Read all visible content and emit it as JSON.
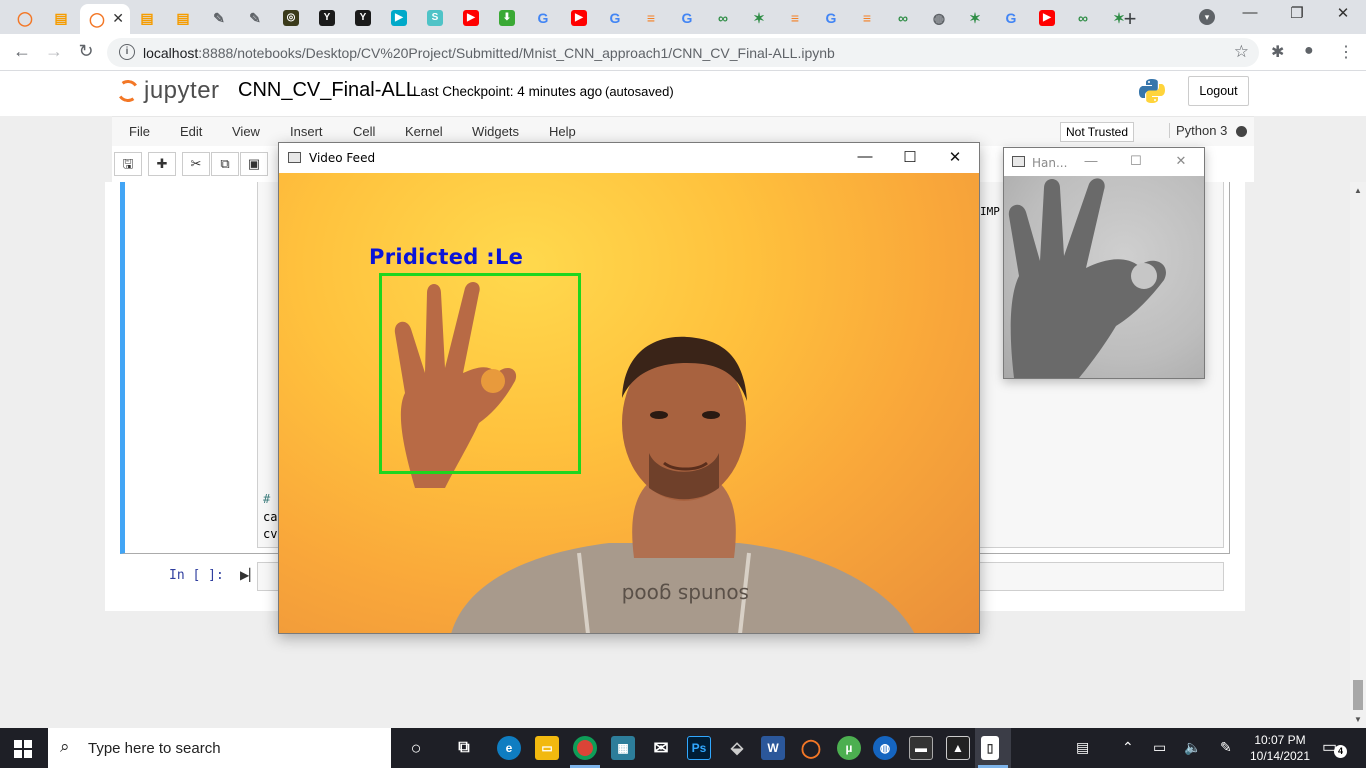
{
  "browser": {
    "tabs": [
      {
        "icon": "jupyter-icon",
        "color": "#f37726",
        "glyph": "◯"
      },
      {
        "icon": "notebook-icon",
        "color": "#f59c00",
        "glyph": "▤"
      },
      {
        "icon": "jupyter-icon",
        "color": "#f37726",
        "glyph": "◯",
        "active": true
      },
      {
        "icon": "notebook-icon",
        "color": "#f59c00",
        "glyph": "▤"
      },
      {
        "icon": "notebook-icon",
        "color": "#f59c00",
        "glyph": "▤"
      },
      {
        "icon": "feather-icon",
        "color": "#5f6368",
        "glyph": "✎"
      },
      {
        "icon": "feather-icon",
        "color": "#5f6368",
        "glyph": "✎"
      },
      {
        "icon": "library-icon",
        "color": "#3b3b1b",
        "glyph": "◎"
      },
      {
        "icon": "y-icon",
        "color": "#1b1b1b",
        "glyph": "Y"
      },
      {
        "icon": "y-icon",
        "color": "#1b1b1b",
        "glyph": "Y"
      },
      {
        "icon": "play-icon",
        "color": "#00a9c9",
        "glyph": "▶"
      },
      {
        "icon": "s-icon",
        "color": "#4fc3c7",
        "glyph": "S"
      },
      {
        "icon": "youtube-icon",
        "color": "#ff0000",
        "glyph": "▶"
      },
      {
        "icon": "download-icon",
        "color": "#3aa935",
        "glyph": "⬇"
      },
      {
        "icon": "google-icon",
        "color": "#ffffff",
        "glyph": "G"
      },
      {
        "icon": "youtube-icon",
        "color": "#ff0000",
        "glyph": "▶"
      },
      {
        "icon": "google-icon",
        "color": "#ffffff",
        "glyph": "G"
      },
      {
        "icon": "stackoverflow-icon",
        "color": "#f48024",
        "glyph": "≡"
      },
      {
        "icon": "google-icon",
        "color": "#ffffff",
        "glyph": "G"
      },
      {
        "icon": "geeks-icon",
        "color": "#2f8d46",
        "glyph": "∞"
      },
      {
        "icon": "plant-icon",
        "color": "#2f8d46",
        "glyph": "✶"
      },
      {
        "icon": "stackoverflow-icon",
        "color": "#f48024",
        "glyph": "≡"
      },
      {
        "icon": "google-icon",
        "color": "#ffffff",
        "glyph": "G"
      },
      {
        "icon": "stackoverflow-icon",
        "color": "#f48024",
        "glyph": "≡"
      },
      {
        "icon": "geeks-icon",
        "color": "#2f8d46",
        "glyph": "∞"
      },
      {
        "icon": "globe-icon",
        "color": "#5f6368",
        "glyph": "◍"
      },
      {
        "icon": "plant-icon",
        "color": "#2f8d46",
        "glyph": "✶"
      },
      {
        "icon": "google-icon",
        "color": "#ffffff",
        "glyph": "G"
      },
      {
        "icon": "youtube-icon",
        "color": "#ff0000",
        "glyph": "▶"
      },
      {
        "icon": "geeks-icon",
        "color": "#2f8d46",
        "glyph": "∞"
      },
      {
        "icon": "plant-icon",
        "color": "#2f8d46",
        "glyph": "✶"
      }
    ],
    "url_host": "localhost",
    "url_rest": ":8888/notebooks/Desktop/CV%20Project/Submitted/Mnist_CNN_approach1/CNN_CV_Final-ALL.ipynb"
  },
  "jupyter": {
    "logo_text": "jupyter",
    "notebook_name": "CNN_CV_Final-ALL",
    "checkpoint": "Last Checkpoint: 4 minutes ago",
    "autosave": "(autosaved)",
    "logout": "Logout",
    "menu": [
      "File",
      "Edit",
      "View",
      "Insert",
      "Cell",
      "Kernel",
      "Widgets",
      "Help"
    ],
    "trust": "Not Trusted",
    "kernel": "Python 3",
    "code_fragments": [
      "#",
      "ca",
      "cv",
      "IMP"
    ],
    "prompt": "In [ ]:"
  },
  "video_window": {
    "title": "Video Feed",
    "prediction": "Pridicted :Le",
    "box_color": "#1ed61e",
    "label_color": "#0a14d8"
  },
  "hand_window": {
    "title": "Han..."
  },
  "taskbar": {
    "search_placeholder": "Type here to search",
    "time": "10:07 PM",
    "date": "10/14/2021",
    "notifications": "4"
  }
}
